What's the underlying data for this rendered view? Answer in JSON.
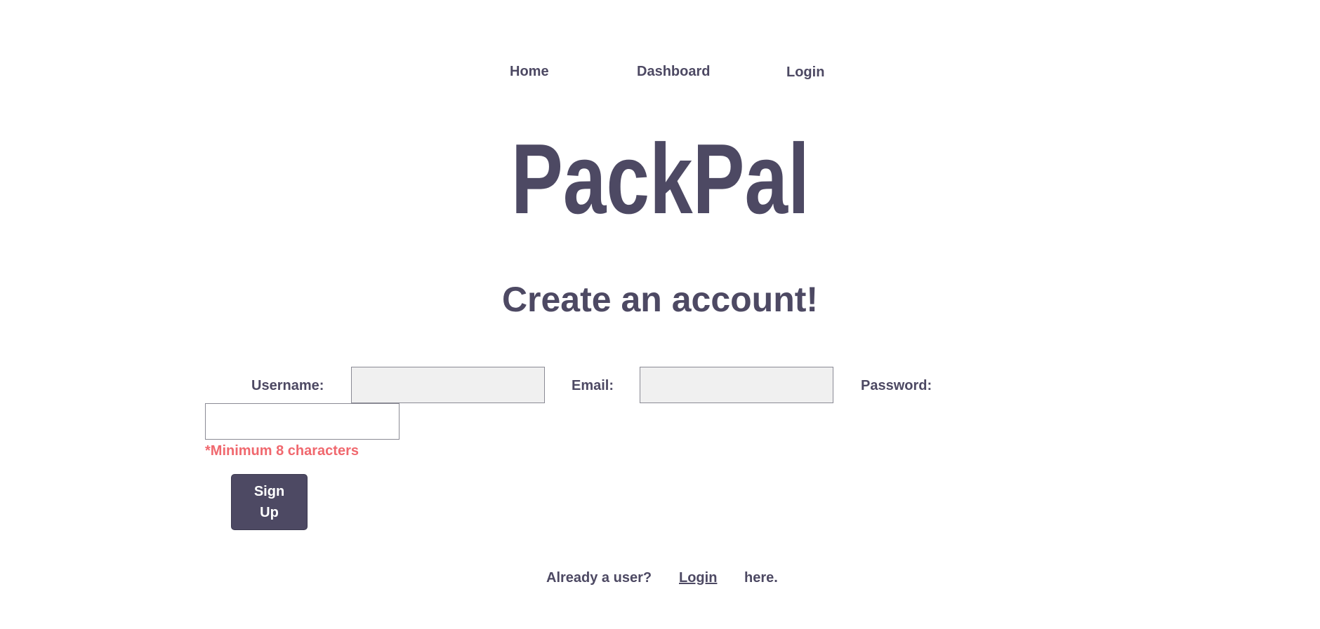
{
  "nav": {
    "home": "Home",
    "dashboard": "Dashboard",
    "login": "Login"
  },
  "logo": {
    "text": "PackPal"
  },
  "heading": "Create an account!",
  "form": {
    "username_label": "Username:",
    "username_value": "",
    "email_label": "Email:",
    "email_value": "",
    "password_label": "Password:",
    "password_value": "",
    "password_hint": "*Minimum 8 characters",
    "submit_label": "Sign Up"
  },
  "footer": {
    "prefix": "Already a user?",
    "link": "Login",
    "suffix": "here."
  },
  "colors": {
    "primary": "#4d4963",
    "error": "#f0686e",
    "input_bg": "#f0f0f0"
  }
}
